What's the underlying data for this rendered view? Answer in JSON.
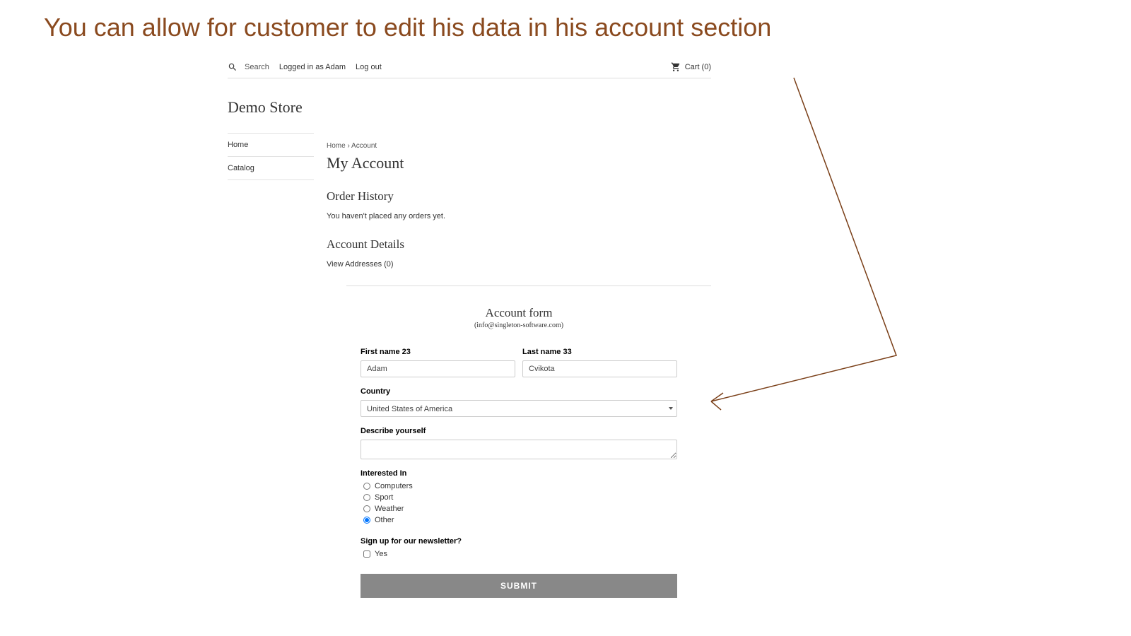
{
  "headline": "You can allow for customer to edit his data in his account section",
  "top_bar": {
    "search_label": "Search",
    "logged_in_text": "Logged in as Adam",
    "logout_text": "Log out",
    "cart_text": "Cart (0)"
  },
  "store_title": "Demo Store",
  "side_nav": [
    "Home",
    "Catalog"
  ],
  "breadcrumb": {
    "home": "Home",
    "sep": "›",
    "current": "Account"
  },
  "page_title": "My Account",
  "order_history": {
    "title": "Order History",
    "text": "You haven't placed any orders yet."
  },
  "account_details": {
    "title": "Account Details",
    "view_addresses": "View Addresses (0)"
  },
  "form": {
    "title": "Account form",
    "subtitle": "(info@singleton-software.com)",
    "first_name_label": "First name 23",
    "first_name_value": "Adam",
    "last_name_label": "Last name 33",
    "last_name_value": "Cvikota",
    "country_label": "Country",
    "country_value": "United States of America",
    "describe_label": "Describe yourself",
    "describe_value": "",
    "interested_label": "Interested In",
    "interested_options": [
      {
        "label": "Computers",
        "checked": false
      },
      {
        "label": "Sport",
        "checked": false
      },
      {
        "label": "Weather",
        "checked": false
      },
      {
        "label": "Other",
        "checked": true
      }
    ],
    "newsletter_label": "Sign up for our newsletter?",
    "newsletter_option": "Yes",
    "newsletter_checked": false,
    "submit_label": "SUBMIT"
  }
}
